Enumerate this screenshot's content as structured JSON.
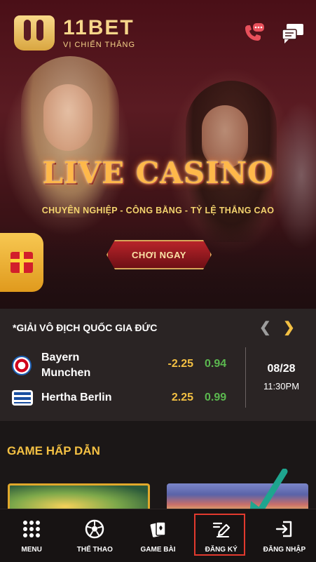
{
  "brand": {
    "name": "11BET",
    "tagline": "VỊ CHIẾN THẮNG"
  },
  "banner": {
    "title": "LIVE CASINO",
    "subtitle": "CHUYÊN NGHIỆP - CÔNG BẰNG - TỶ LỆ THẮNG CAO",
    "cta_label": "CHƠI NGAY"
  },
  "match": {
    "league": "*GIẢI VÔ ĐỊCH QUỐC GIA ĐỨC",
    "home": {
      "name_line1": "Bayern",
      "name_line2": "Munchen",
      "handicap": "-2.25",
      "odds": "0.94"
    },
    "away": {
      "name": "Hertha Berlin",
      "handicap": "2.25",
      "odds": "0.99"
    },
    "date": "08/28",
    "time": "11:30PM"
  },
  "games": {
    "title": "GAME HẤP DẪN"
  },
  "bottom_nav": {
    "menu": "MENU",
    "sports": "THỂ THAO",
    "card_games": "GAME BÀI",
    "register": "ĐĂNG KÝ",
    "login": "ĐĂNG NHẬP"
  },
  "colors": {
    "accent_gold": "#f3c043",
    "odds_green": "#5bb84f",
    "highlight_red": "#e23a2e",
    "arrow_teal": "#1ea58f"
  }
}
